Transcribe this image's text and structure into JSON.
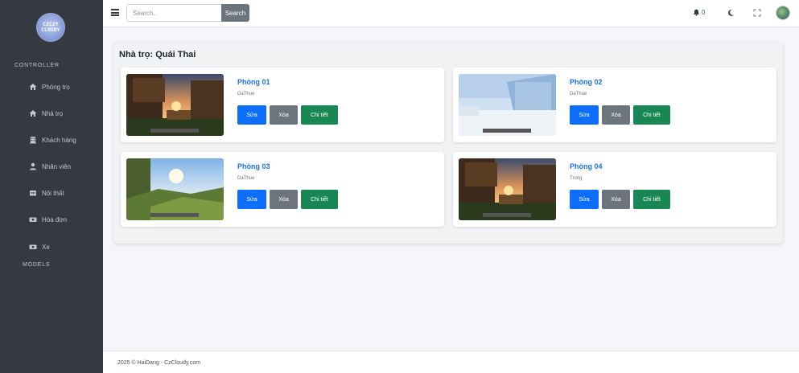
{
  "sidebar": {
    "logo_text": "CZCZY CLOUDY",
    "section_controller": "CONTROLLER",
    "section_models": "MODELS",
    "items": [
      {
        "label": "Phòng trọ",
        "icon": "house-door-icon"
      },
      {
        "label": "Nhà trọ",
        "icon": "home-icon"
      },
      {
        "label": "Khách hàng",
        "icon": "building-icon"
      },
      {
        "label": "Nhân viên",
        "icon": "user-icon"
      },
      {
        "label": "Nội thất",
        "icon": "furniture-icon"
      },
      {
        "label": "Hóa đơn",
        "icon": "invoice-icon"
      },
      {
        "label": "Xe",
        "icon": "vehicle-icon"
      }
    ]
  },
  "topbar": {
    "search_placeholder": "Search..",
    "search_button": "Search",
    "notification_count": "0"
  },
  "content": {
    "title": "Nhà trọ: Quái Thai",
    "rooms": [
      {
        "name": "Phòng 01",
        "status": "DaThue",
        "edit": "Sửa",
        "delete": "Xóa",
        "detail": "Chi tiết",
        "scene": "sunset-forest"
      },
      {
        "name": "Phòng 02",
        "status": "DaThue",
        "edit": "Sửa",
        "delete": "Xóa",
        "detail": "Chi tiết",
        "scene": "snow"
      },
      {
        "name": "Phòng 03",
        "status": "DaThue",
        "edit": "Sửa",
        "delete": "Xóa",
        "detail": "Chi tiết",
        "scene": "sunny-hills"
      },
      {
        "name": "Phòng 04",
        "status": "Trong",
        "edit": "Sửa",
        "delete": "Xóa",
        "detail": "Chi tiết",
        "scene": "sunset-forest"
      }
    ]
  },
  "footer": {
    "text": "2025 © HaiDang - CzCloudy.com"
  },
  "colors": {
    "sidebar_bg": "#343a40",
    "primary": "#0d6efd",
    "secondary": "#6c757d",
    "success": "#198754",
    "link": "#1a73e8"
  }
}
